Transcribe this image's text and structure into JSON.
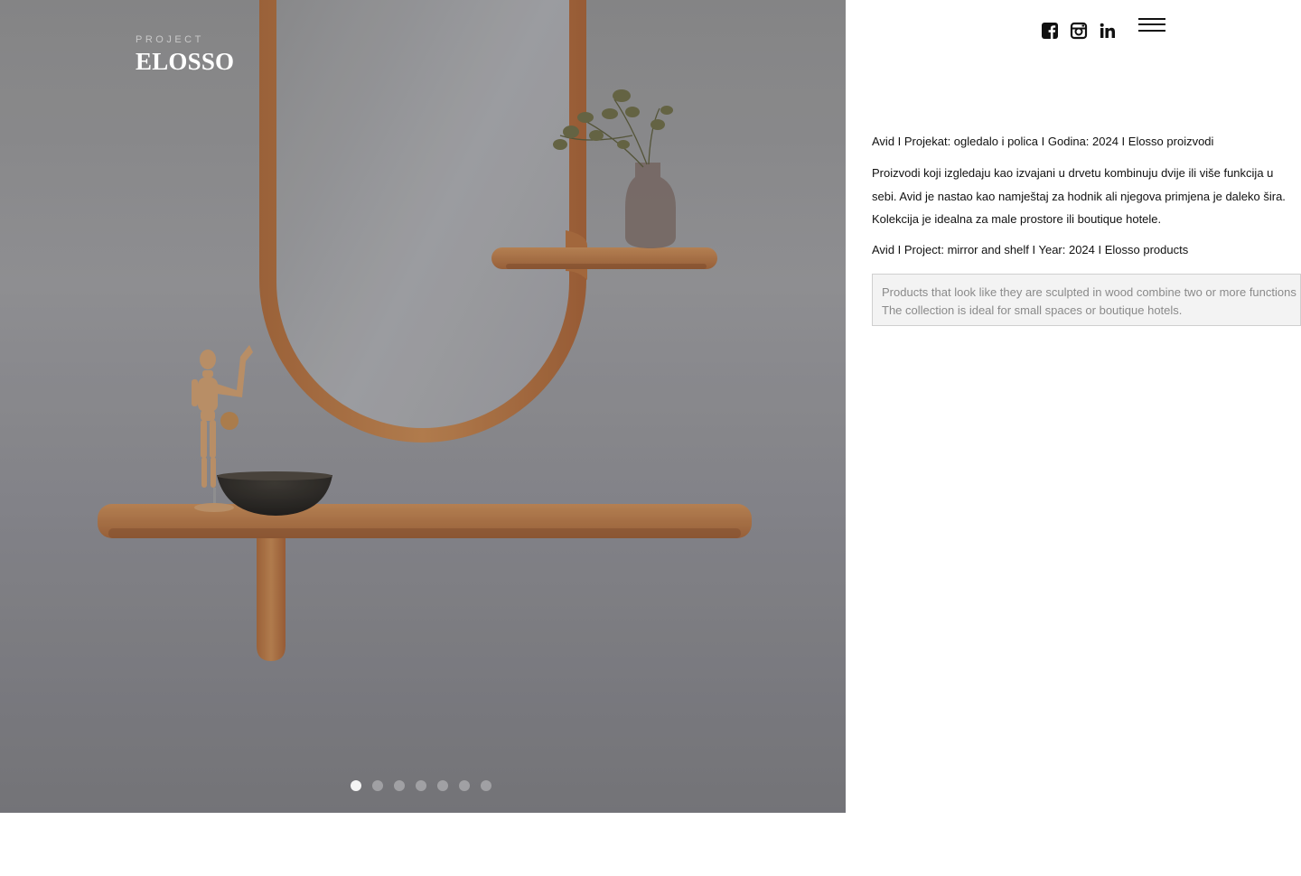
{
  "brand": {
    "kicker": "PROJECT",
    "title": "ELOSSO"
  },
  "slider": {
    "total": 7,
    "active_index": 0
  },
  "header": {
    "social": [
      {
        "name": "facebook-icon",
        "label": "Facebook"
      },
      {
        "name": "instagram-icon",
        "label": "Instagram"
      },
      {
        "name": "linkedin-icon",
        "label": "LinkedIn"
      }
    ],
    "menu_icon": "hamburger-menu-icon"
  },
  "content": {
    "meta_hr": "Avid  I  Projekat: ogledalo i polica  I  Godina: 2024  I  Elosso proizvodi",
    "desc_hr": [
      "Proizvodi koji izgledaju kao izvajani u drvetu kombinuju dvije ili više funkcija u",
      "sebi. Avid je nastao kao namještaj za hodnik ali njegova primjena je daleko šira.",
      "Kolekcija je idealna za male prostore ili boutique hotele."
    ],
    "meta_en": "Avid  I  Project: mirror and shelf  I  Year: 2024  I  Elosso products",
    "desc_en": [
      "Products that look like they are sculpted in wood combine two or more functions",
      "The collection is ideal for small spaces or boutique hotels."
    ]
  },
  "colors": {
    "wall": "#8f8f8f",
    "wood": "#b7773f",
    "text": "#111111",
    "textarea_bg": "#f3f3f3"
  }
}
